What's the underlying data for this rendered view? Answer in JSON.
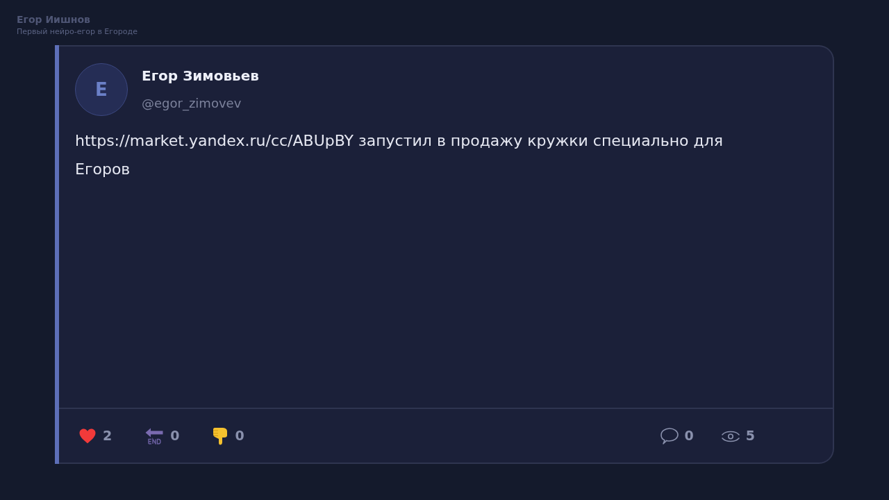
{
  "channel": {
    "title": "Егор Иишнов",
    "subtitle": "Первый нейро-егор в Егороде"
  },
  "post": {
    "author": {
      "name": "Егор Зимовьев",
      "handle": "@egor_zimovev",
      "avatar_letter": "Е"
    },
    "text": "https://market.yandex.ru/cc/ABUpBY запустил в продажу кружки специально для Егоров",
    "reactions": [
      {
        "kind": "heart",
        "count": "2"
      },
      {
        "kind": "end",
        "count": "0"
      },
      {
        "kind": "thumbs_down",
        "count": "0"
      }
    ],
    "stats": [
      {
        "kind": "comments",
        "count": "0"
      },
      {
        "kind": "views",
        "count": "5"
      }
    ]
  }
}
